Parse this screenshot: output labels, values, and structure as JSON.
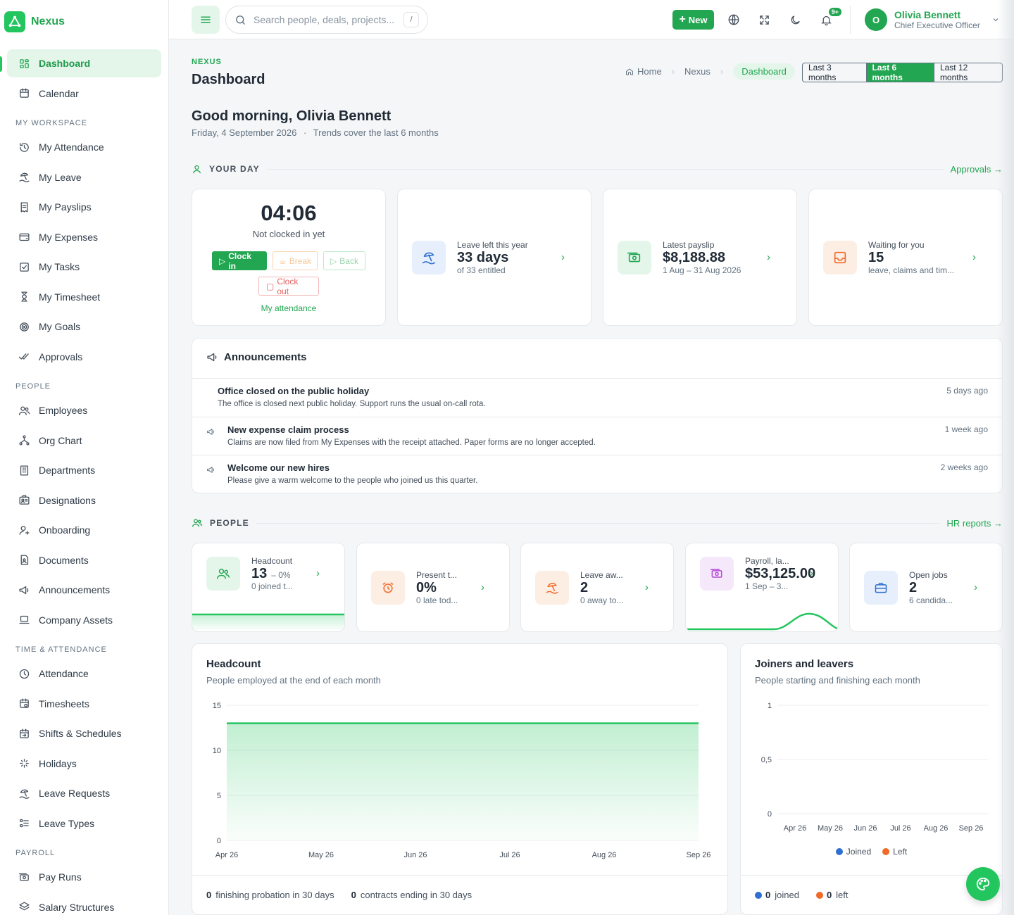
{
  "brand": {
    "name": "Nexus",
    "accent": "#22a651"
  },
  "sidebar": {
    "top_items": [
      {
        "label": "Dashboard",
        "icon": "grid-icon",
        "active": true
      },
      {
        "label": "Calendar",
        "icon": "calendar-icon"
      }
    ],
    "sections": [
      {
        "title": "MY WORKSPACE",
        "items": [
          {
            "label": "My Attendance",
            "icon": "clock-history-icon"
          },
          {
            "label": "My Leave",
            "icon": "umbrella-beach-icon"
          },
          {
            "label": "My Payslips",
            "icon": "receipt-icon"
          },
          {
            "label": "My Expenses",
            "icon": "wallet-icon"
          },
          {
            "label": "My Tasks",
            "icon": "checkbox-icon"
          },
          {
            "label": "My Timesheet",
            "icon": "hourglass-icon"
          },
          {
            "label": "My Goals",
            "icon": "target-icon"
          },
          {
            "label": "Approvals",
            "icon": "double-check-icon"
          }
        ]
      },
      {
        "title": "PEOPLE",
        "items": [
          {
            "label": "Employees",
            "icon": "users-icon"
          },
          {
            "label": "Org Chart",
            "icon": "org-chart-icon"
          },
          {
            "label": "Departments",
            "icon": "building-icon"
          },
          {
            "label": "Designations",
            "icon": "id-badge-icon"
          },
          {
            "label": "Onboarding",
            "icon": "user-plus-icon"
          },
          {
            "label": "Documents",
            "icon": "document-user-icon"
          },
          {
            "label": "Announcements",
            "icon": "megaphone-icon"
          },
          {
            "label": "Company Assets",
            "icon": "laptop-icon"
          }
        ]
      },
      {
        "title": "TIME & ATTENDANCE",
        "items": [
          {
            "label": "Attendance",
            "icon": "clock-icon"
          },
          {
            "label": "Timesheets",
            "icon": "calendar-clock-icon"
          },
          {
            "label": "Shifts & Schedules",
            "icon": "calendar-repeat-icon"
          },
          {
            "label": "Holidays",
            "icon": "sparkle-icon"
          },
          {
            "label": "Leave Requests",
            "icon": "umbrella-beach-icon"
          },
          {
            "label": "Leave Types",
            "icon": "list-icon"
          }
        ]
      },
      {
        "title": "PAYROLL",
        "items": [
          {
            "label": "Pay Runs",
            "icon": "money-icon"
          },
          {
            "label": "Salary Structures",
            "icon": "stack-icon"
          }
        ]
      }
    ]
  },
  "topbar": {
    "search_placeholder": "Search people, deals, projects...",
    "search_shortcut": "/",
    "new_label": "New",
    "notif_badge": "9+",
    "user": {
      "initial": "O",
      "name": "Olivia Bennett",
      "role": "Chief Executive Officer"
    }
  },
  "header": {
    "eyebrow": "NEXUS",
    "title": "Dashboard",
    "breadcrumbs": [
      "Home",
      "Nexus",
      "Dashboard"
    ],
    "ranges": [
      "Last 3 months",
      "Last 6 months",
      "Last 12 months"
    ],
    "selected_range": "Last 6 months",
    "greeting": "Good morning, Olivia Bennett",
    "date": "Friday, 4 September 2026",
    "trend_note": "Trends cover the last 6 months"
  },
  "your_day": {
    "label": "YOUR DAY",
    "link": "Approvals",
    "clock": {
      "time": "04:06",
      "status": "Not clocked in yet",
      "clock_in": "Clock in",
      "break": "Break",
      "back": "Back",
      "clock_out": "Clock out",
      "link": "My attendance"
    },
    "cards": [
      {
        "label": "Leave left this year",
        "value": "33 days",
        "sub": "of 33 entitled",
        "icon": "umbrella-beach-icon",
        "color": "#2f6fd1",
        "bg": "#e6effb"
      },
      {
        "label": "Latest payslip",
        "value": "$8,188.88",
        "sub": "1 Aug – 31 Aug 2026",
        "icon": "money-icon",
        "color": "#22a651",
        "bg": "#e4f6ea"
      },
      {
        "label": "Waiting for you",
        "value": "15",
        "sub": "leave, claims and tim...",
        "icon": "inbox-icon",
        "color": "#f06a2a",
        "bg": "#fdeee4"
      }
    ]
  },
  "announcements": {
    "title": "Announcements",
    "items": [
      {
        "title": "Office closed on the public holiday",
        "body": "The office is closed next public holiday. Support runs the usual on-call rota.",
        "time": "5 days ago",
        "has_icon": false
      },
      {
        "title": "New expense claim process",
        "body": "Claims are now filed from My Expenses with the receipt attached. Paper forms are no longer accepted.",
        "time": "1 week ago",
        "has_icon": true
      },
      {
        "title": "Welcome our new hires",
        "body": "Please give a warm welcome to the people who joined us this quarter.",
        "time": "2 weeks ago",
        "has_icon": true
      }
    ]
  },
  "people": {
    "label": "PEOPLE",
    "link": "HR reports",
    "kpis": [
      {
        "label": "Headcount",
        "value": "13",
        "delta": "– 0%",
        "sub": "0 joined t...",
        "icon": "users-icon",
        "color": "#22a651",
        "bg": "#e4f6ea"
      },
      {
        "label": "Present t...",
        "value": "0%",
        "delta": "",
        "sub": "0 late tod...",
        "icon": "alarm-icon",
        "color": "#f06a2a",
        "bg": "#fdeee4"
      },
      {
        "label": "Leave aw...",
        "value": "2",
        "delta": "",
        "sub": "0 away to...",
        "icon": "umbrella-beach-icon",
        "color": "#f06a2a",
        "bg": "#fdeee4"
      },
      {
        "label": "Payroll, la...",
        "value": "$53,125.00",
        "delta": "",
        "sub": "1 Sep – 3...",
        "icon": "money-icon",
        "color": "#b44ad6",
        "bg": "#f6e8fb"
      },
      {
        "label": "Open jobs",
        "value": "2",
        "delta": "",
        "sub": "6 candida...",
        "icon": "briefcase-icon",
        "color": "#2f6fd1",
        "bg": "#e6effb"
      }
    ]
  },
  "chart_data": [
    {
      "type": "area",
      "title": "Headcount",
      "subtitle": "People employed at the end of each month",
      "categories": [
        "Apr 26",
        "May 26",
        "Jun 26",
        "Jul 26",
        "Aug 26",
        "Sep 26"
      ],
      "series": [
        {
          "values": [
            13,
            13,
            13,
            13,
            13,
            13
          ],
          "color": "#22c55e"
        }
      ],
      "yticks": [
        0,
        5,
        10,
        15
      ],
      "ylim": [
        0,
        15
      ],
      "footer": [
        {
          "value": "0",
          "label": "finishing probation in 30 days"
        },
        {
          "value": "0",
          "label": "contracts ending in 30 days"
        }
      ]
    },
    {
      "type": "bar",
      "title": "Joiners and leavers",
      "subtitle": "People starting and finishing each month",
      "categories": [
        "Apr 26",
        "May 26",
        "Jun 26",
        "Jul 26",
        "Aug 26",
        "Sep 26"
      ],
      "series": [
        {
          "name": "Joined",
          "values": [
            0,
            0,
            0,
            0,
            0,
            0
          ],
          "color": "#2f6fd1"
        },
        {
          "name": "Left",
          "values": [
            0,
            0,
            0,
            0,
            0,
            0
          ],
          "color": "#f06a2a"
        }
      ],
      "yticks": [
        "0",
        "0,5",
        "1"
      ],
      "ylim": [
        0,
        1
      ],
      "legend": "bottom",
      "footer": [
        {
          "value": "0",
          "label": "joined",
          "color": "#2f6fd1"
        },
        {
          "value": "0",
          "label": "left",
          "color": "#f06a2a"
        }
      ]
    }
  ]
}
